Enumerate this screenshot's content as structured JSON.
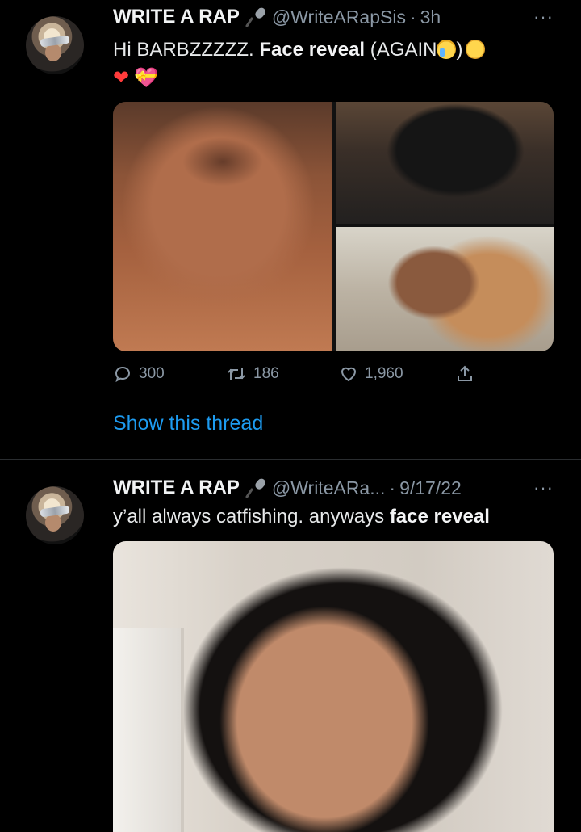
{
  "tweets": [
    {
      "display_name": "WRITE A RAP",
      "handle": "@WriteARapSis",
      "time": "3h",
      "text_plain": "Hi BARBZZZZZ. ",
      "text_bold": "Face reveal",
      "text_tail": " (AGAIN",
      "text_close": ")",
      "more": "···",
      "stats": {
        "replies": "300",
        "retweets": "186",
        "likes": "1,960"
      },
      "thread_link": "Show this thread"
    },
    {
      "display_name": "WRITE A RAP",
      "handle": "@WriteARa...",
      "time": "9/17/22",
      "text_plain": "y’all always catfishing.  anyways ",
      "text_bold": "face reveal",
      "more": "···"
    }
  ],
  "icons": {
    "microphone": "microphone-icon",
    "crying": "loudly-crying-face-emoji",
    "laughing": "rolling-on-floor-laughing-emoji",
    "red_heart": "red-heart-emoji",
    "pink_heart": "heart-with-ribbon-emoji",
    "reply": "reply-icon",
    "retweet": "retweet-icon",
    "like": "like-icon",
    "share": "share-icon"
  },
  "colors": {
    "background": "#000000",
    "link": "#1d9bf0",
    "muted": "#8b98a5"
  }
}
